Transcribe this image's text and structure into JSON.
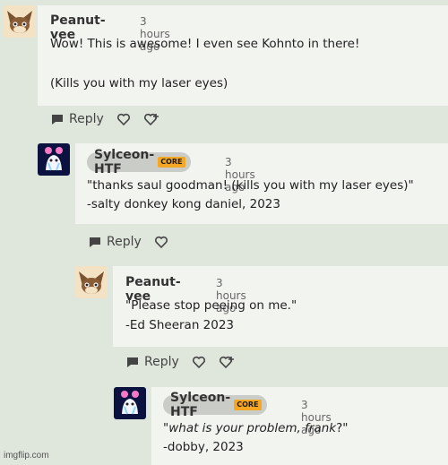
{
  "comments": [
    {
      "author": "Peanut-vee",
      "time": "3 hours ago",
      "lines": [
        "Wow! This is awesome! I even see Kohnto in there!",
        "",
        "(Kills you with my laser eyes)"
      ],
      "reply_label": "Reply"
    },
    {
      "author": "Sylceon-HTF",
      "badge": "CORE",
      "time": "3 hours ago",
      "lines": [
        "\"thanks saul goodman! (kills you with my laser eyes)\"",
        "-salty donkey kong daniel, 2023"
      ],
      "reply_label": "Reply"
    },
    {
      "author": "Peanut-vee",
      "time": "3 hours ago",
      "lines": [
        "\"Please stop peeing on me.\"",
        "-Ed Sheeran 2023"
      ],
      "reply_label": "Reply"
    },
    {
      "author": "Sylceon-HTF",
      "badge": "CORE",
      "time": "3 hours ago",
      "quote_open": "\"",
      "quote_italic": "what is your problem, frank",
      "quote_close": "?\"",
      "lines": [
        "",
        "-dobby, 2023"
      ]
    }
  ],
  "watermark": "imgflip.com",
  "colors": {
    "background": "#dfe6dc",
    "bubble": "#f2f4f0",
    "badge": "#f5a623"
  }
}
